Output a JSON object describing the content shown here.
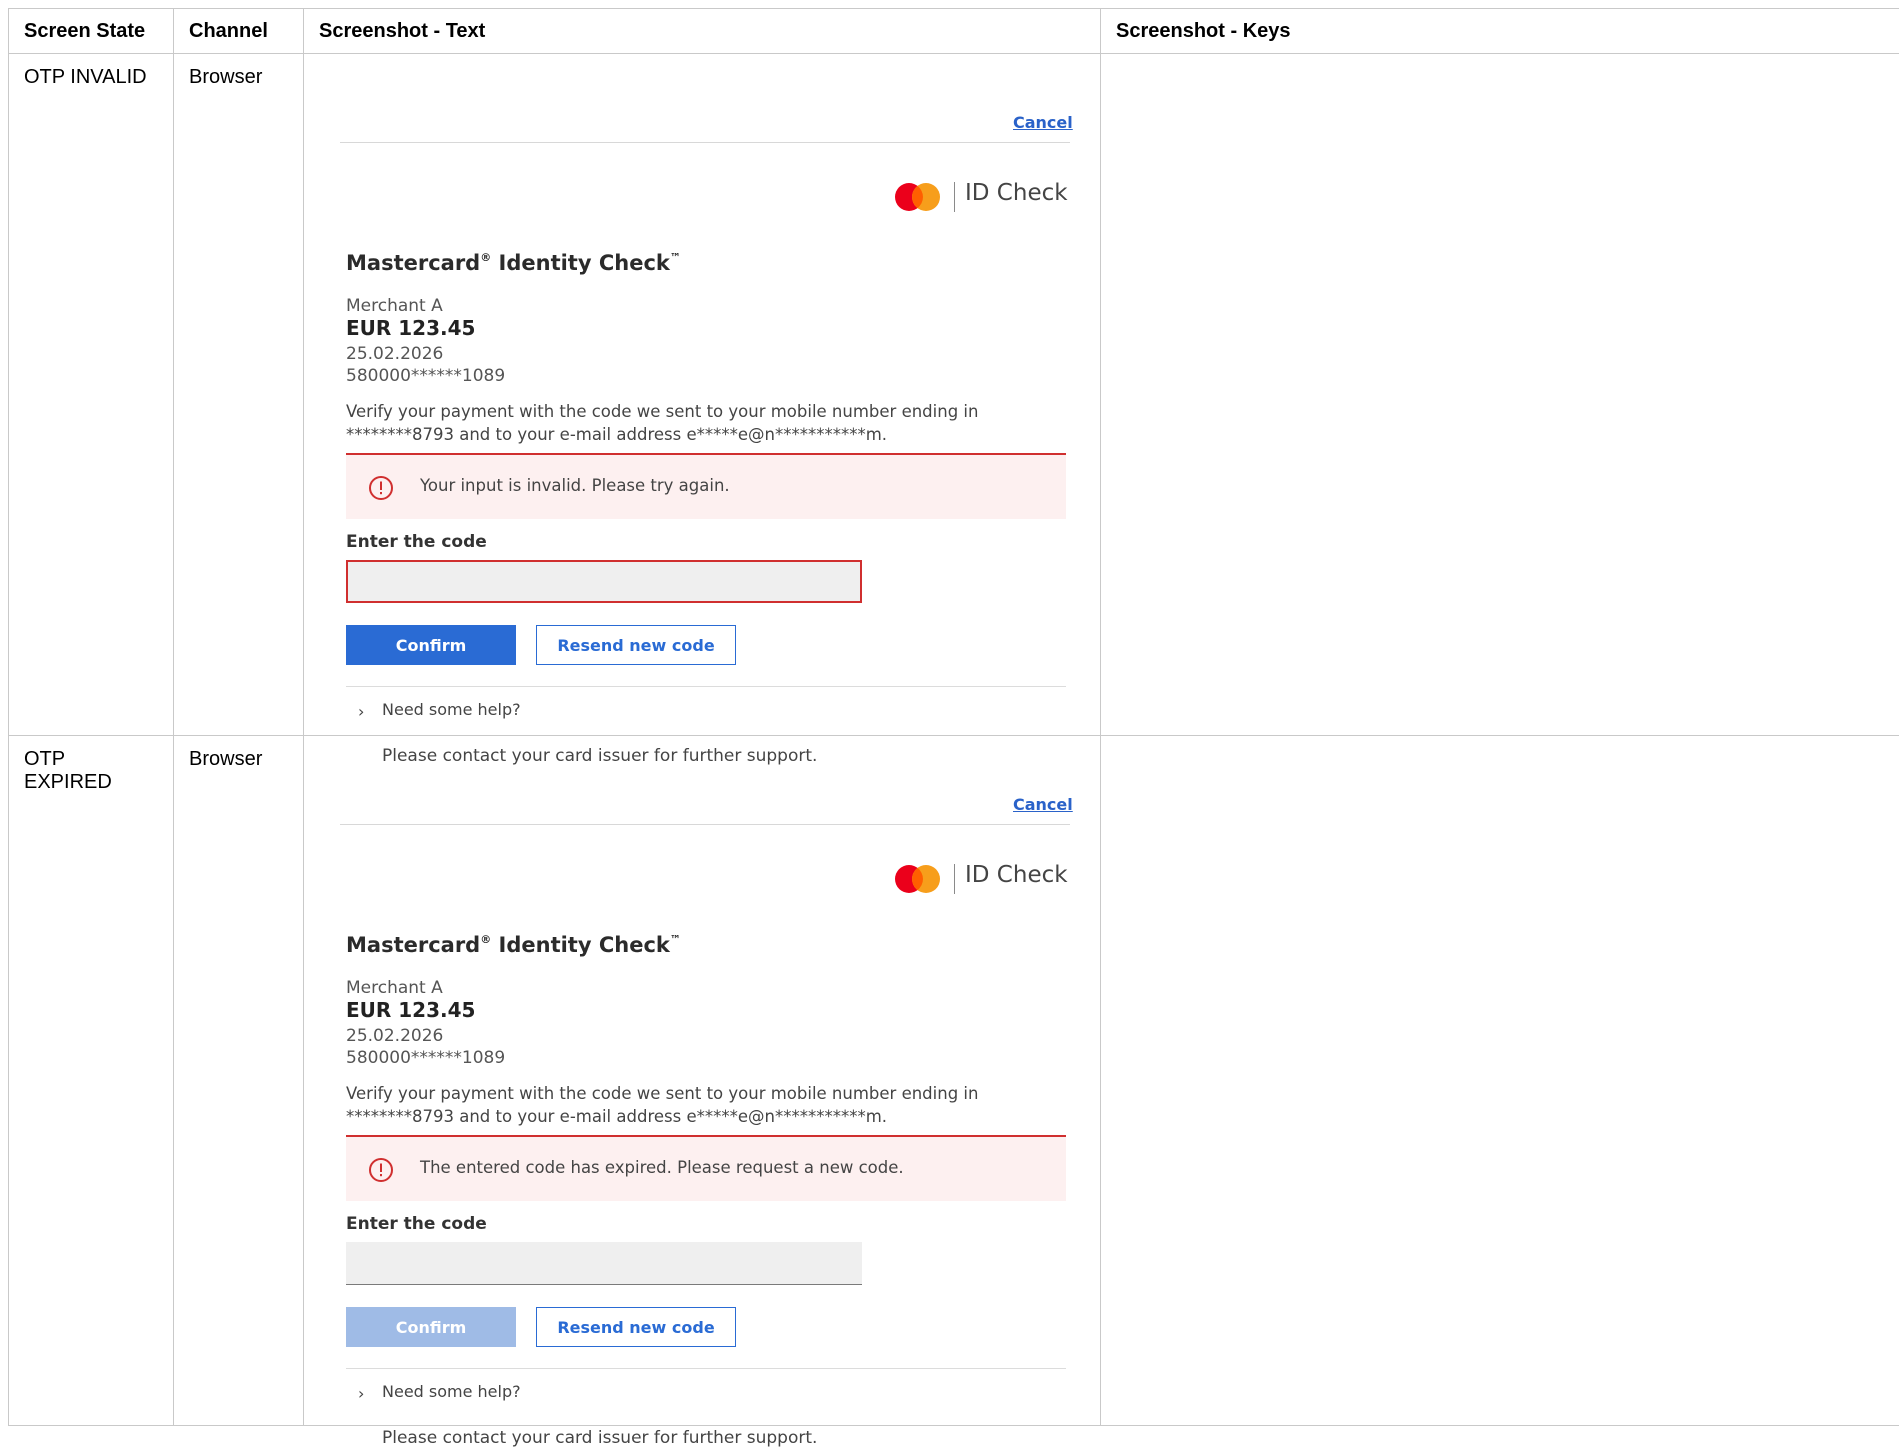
{
  "table": {
    "headers": [
      "Screen State",
      "Channel",
      "Screenshot - Text",
      "Screenshot - Keys"
    ]
  },
  "rows": [
    {
      "state": "OTP INVALID",
      "channel": "Browser",
      "screen": {
        "cancel": "Cancel",
        "brand_text": "ID Check",
        "title": "Mastercard",
        "title_reg": "®",
        "title_rest": " Identity Check",
        "title_tm": "™",
        "merchant": "Merchant A",
        "amount": "EUR 123.45",
        "date": "25.02.2026",
        "pan": "580000******1089",
        "verify_line1": "Verify your payment with the code we sent to your mobile number ending in",
        "verify_line2": "********8793 and to your e-mail address e*****e@n***********m.",
        "alert": "Your input is invalid. Please try again.",
        "code_label": "Enter the code",
        "confirm": "Confirm",
        "resend": "Resend new code",
        "help": "Need some help?",
        "support": "Please contact your card issuer for further support."
      }
    },
    {
      "state": "OTP EXPIRED",
      "channel": "Browser",
      "screen": {
        "cancel": "Cancel",
        "brand_text": "ID Check",
        "title": "Mastercard",
        "title_reg": "®",
        "title_rest": " Identity Check",
        "title_tm": "™",
        "merchant": "Merchant A",
        "amount": "EUR 123.45",
        "date": "25.02.2026",
        "pan": "580000******1089",
        "verify_line1": "Verify your payment with the code we sent to your mobile number ending in",
        "verify_line2": "********8793 and to your e-mail address e*****e@n***********m.",
        "alert": "The entered code has expired. Please request a new code.",
        "code_label": "Enter the code",
        "confirm": "Confirm",
        "resend": "Resend new code",
        "help": "Need some help?",
        "support": "Please contact your card issuer for further support."
      }
    }
  ],
  "colors": {
    "accent_blue": "#2a6bd4",
    "error_red": "#d02f2f",
    "mc_red": "#eb001b",
    "mc_orange": "#f79e1b"
  },
  "icons": [
    "mastercard-logo-icon",
    "alert-circle-icon",
    "chevron-right-icon"
  ]
}
